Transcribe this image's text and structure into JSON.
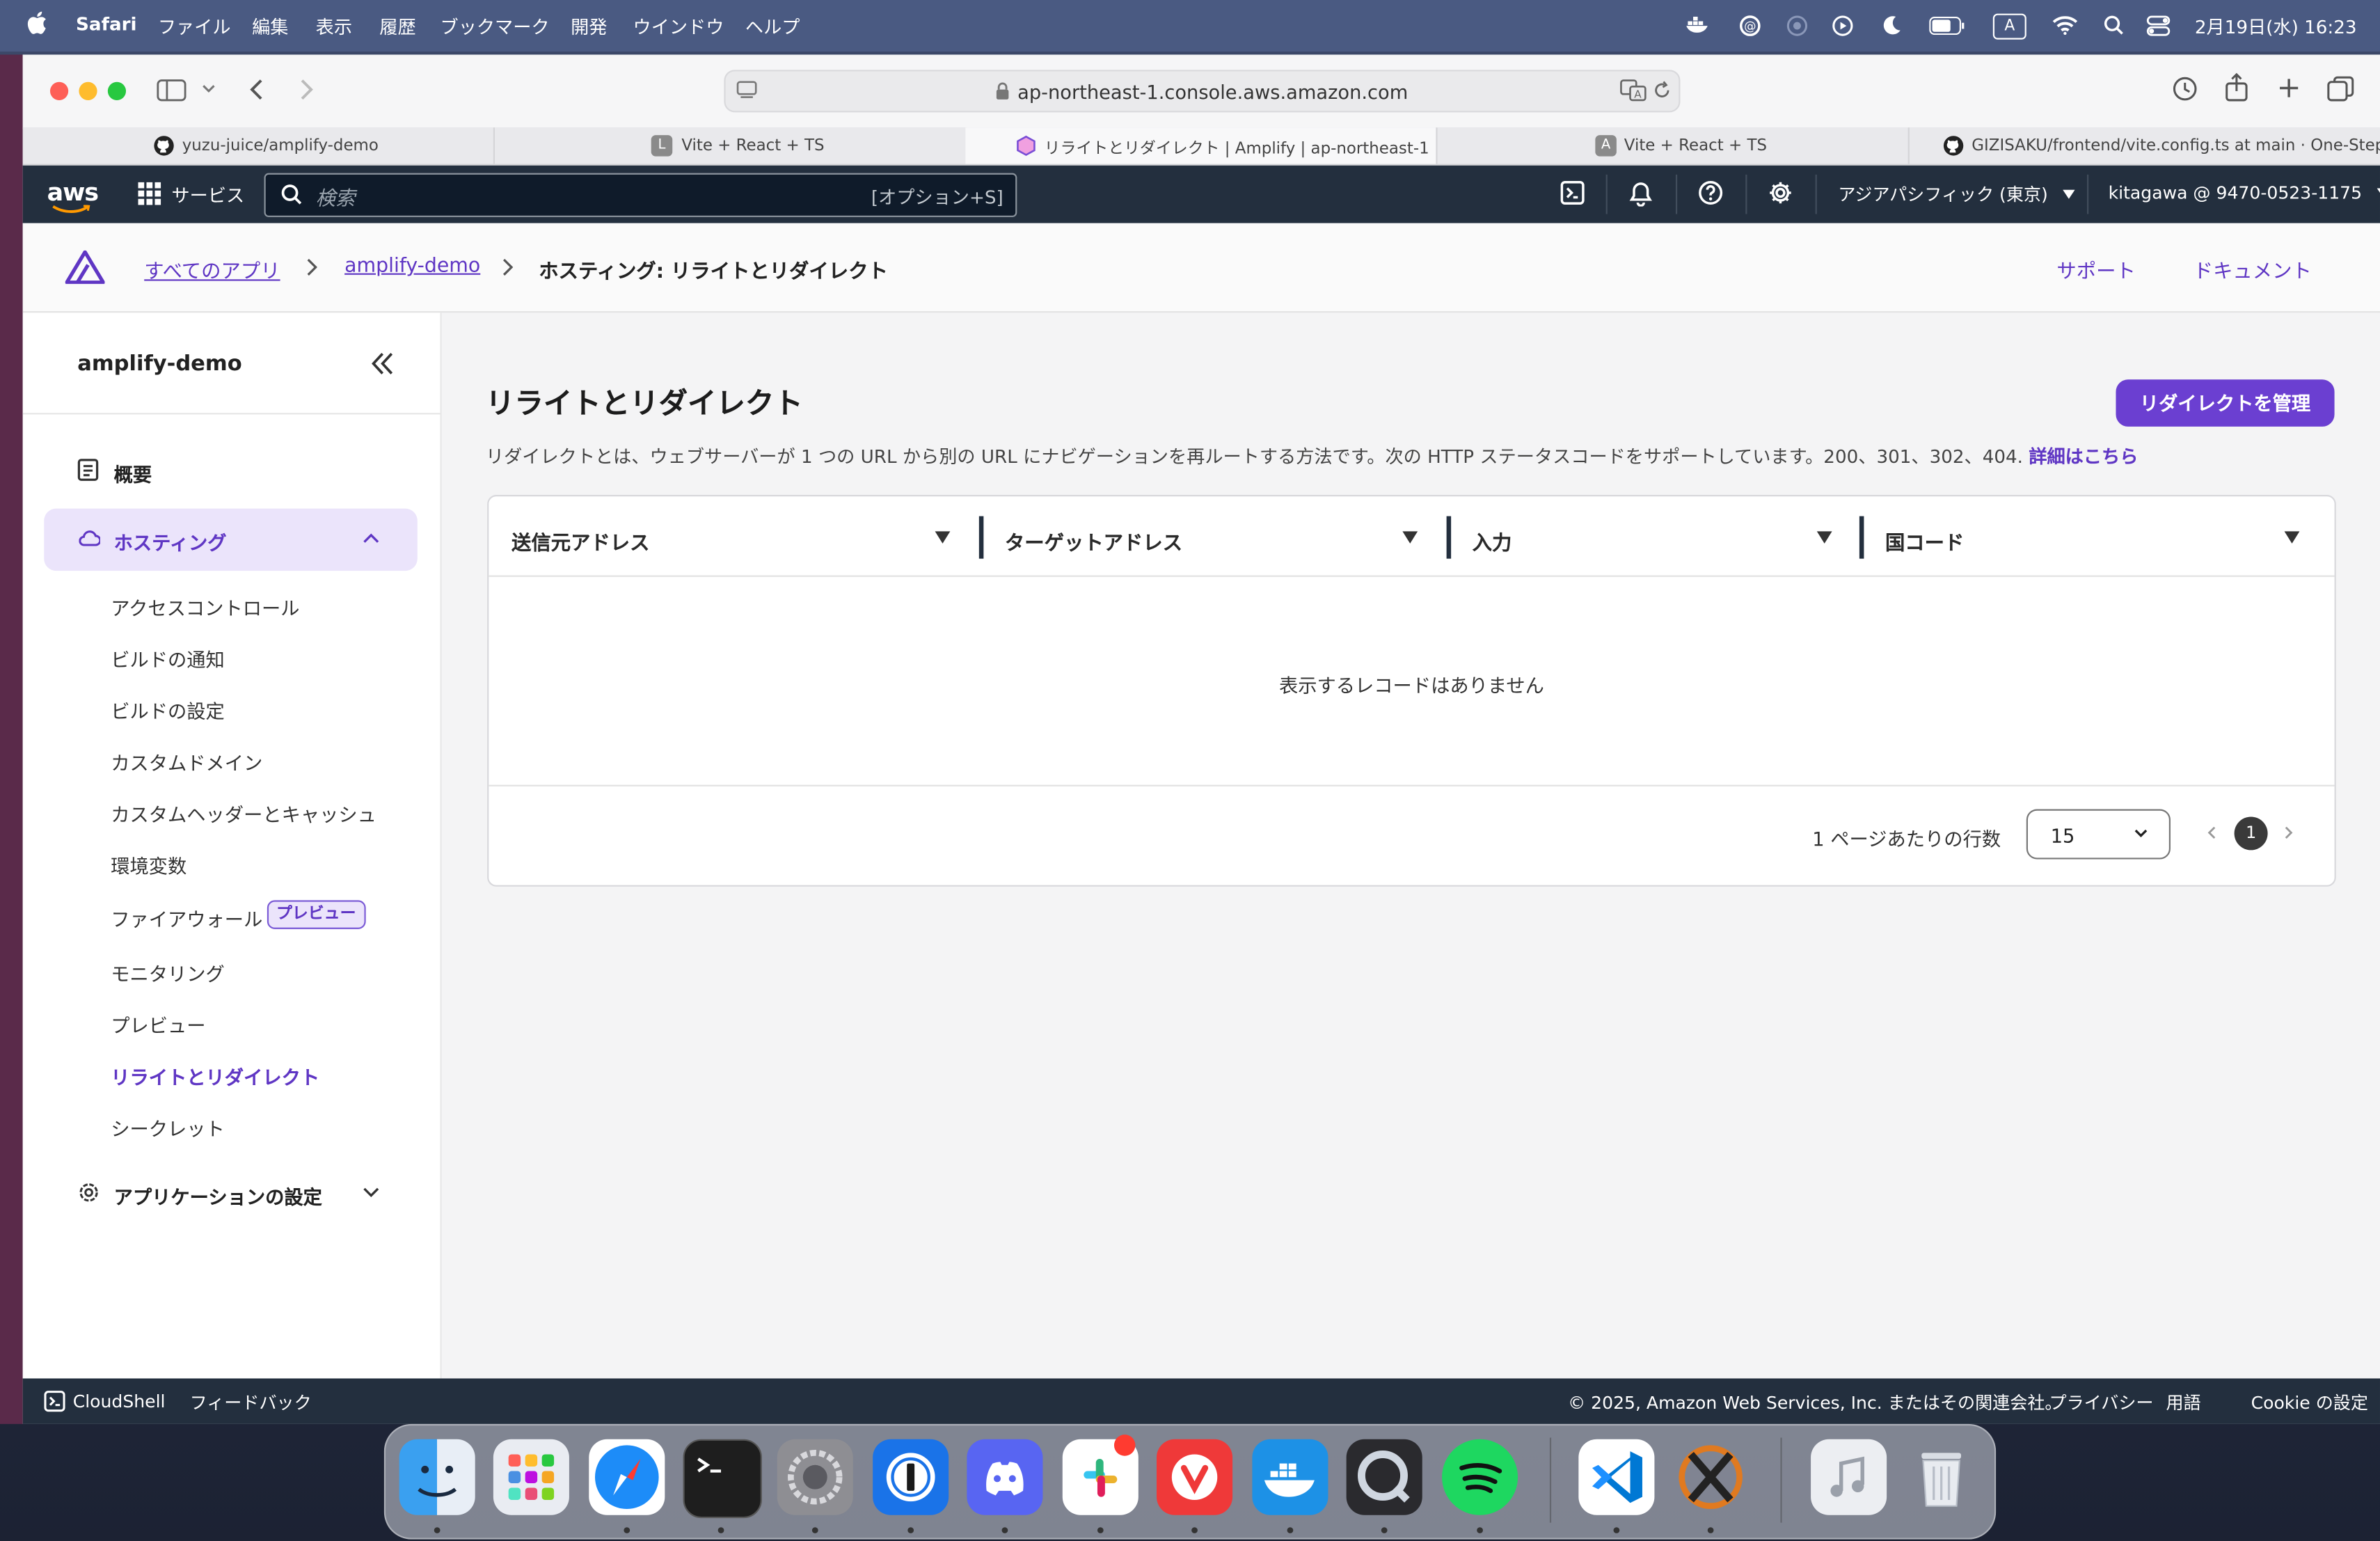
{
  "menubar": {
    "apple": "",
    "app": "Safari",
    "items": [
      "ファイル",
      "編集",
      "表示",
      "履歴",
      "ブックマーク",
      "開発",
      "ウインドウ",
      "ヘルプ"
    ],
    "input_indicator": "A",
    "datetime": "2月19日(水) 16:23"
  },
  "browser": {
    "url": "ap-northeast-1.console.aws.amazon.com",
    "tabs": [
      {
        "label": "yuzu-juice/amplify-demo",
        "icon": "github-icon",
        "active": false
      },
      {
        "label": "Vite + React + TS",
        "icon": "L",
        "active": false
      },
      {
        "label": "リライトとリダイレクト | Amplify | ap-northeast-1",
        "icon": "amplify-icon",
        "active": true
      },
      {
        "label": "Vite + React + TS",
        "icon": "A",
        "active": false
      },
      {
        "label": "GIZISAKU/frontend/vite.config.ts at main · One-Steps/...",
        "icon": "github-icon",
        "active": false
      }
    ]
  },
  "aws_nav": {
    "logo": "aws",
    "services": "サービス",
    "search_placeholder": "検索",
    "search_shortcut": "[オプション+S]",
    "region": "アジアパシフィック (東京)",
    "account": "kitagawa @ 9470-0523-1175"
  },
  "amplify_header": {
    "breadcrumbs": [
      "すべてのアプリ",
      "amplify-demo",
      "ホスティング: リライトとリダイレクト"
    ],
    "support": "サポート",
    "docs": "ドキュメント"
  },
  "sidebar": {
    "app_name": "amplify-demo",
    "overview": "概要",
    "hosting": "ホスティング",
    "hosting_items": [
      {
        "label": "アクセスコントロール"
      },
      {
        "label": "ビルドの通知"
      },
      {
        "label": "ビルドの設定"
      },
      {
        "label": "カスタムドメイン"
      },
      {
        "label": "カスタムヘッダーとキャッシュ"
      },
      {
        "label": "環境変数"
      },
      {
        "label": "ファイアウォール",
        "badge": "プレビュー"
      },
      {
        "label": "モニタリング"
      },
      {
        "label": "プレビュー"
      },
      {
        "label": "リライトとリダイレクト",
        "active": true
      },
      {
        "label": "シークレット"
      }
    ],
    "app_settings": "アプリケーションの設定"
  },
  "main": {
    "title": "リライトとリダイレクト",
    "manage_button": "リダイレクトを管理",
    "description": "リダイレクトとは、ウェブサーバーが 1 つの URL から別の URL にナビゲーションを再ルートする方法です。次の HTTP ステータスコードをサポートしています。200、301、302、404.",
    "details_link": "詳細はこちら",
    "columns": [
      "送信元アドレス",
      "ターゲットアドレス",
      "入力",
      "国コード"
    ],
    "empty_message": "表示するレコードはありません",
    "rows_per_page_label": "1 ページあたりの行数",
    "rows_per_page_value": "15",
    "page": "1"
  },
  "footer": {
    "cloudshell": "CloudShell",
    "feedback": "フィードバック",
    "copyright": "© 2025, Amazon Web Services, Inc. またはその関連会社。",
    "privacy": "プライバシー",
    "terms": "用語",
    "cookie": "Cookie の設定"
  },
  "dock": {
    "apps": [
      "finder-icon",
      "launchpad-icon",
      "safari-icon",
      "terminal-icon",
      "system-settings-icon",
      "1password-icon",
      "discord-icon",
      "slack-icon",
      "vivaldi-icon",
      "docker-icon",
      "quicktime-icon",
      "spotify-icon",
      "vscode-icon",
      "xquartz-icon",
      "music-icon",
      "trash-icon"
    ]
  },
  "colors": {
    "amplify_purple": "#5f36c4",
    "aws_nav": "#232f3e",
    "active_nav_bg": "#ebe4fb"
  }
}
